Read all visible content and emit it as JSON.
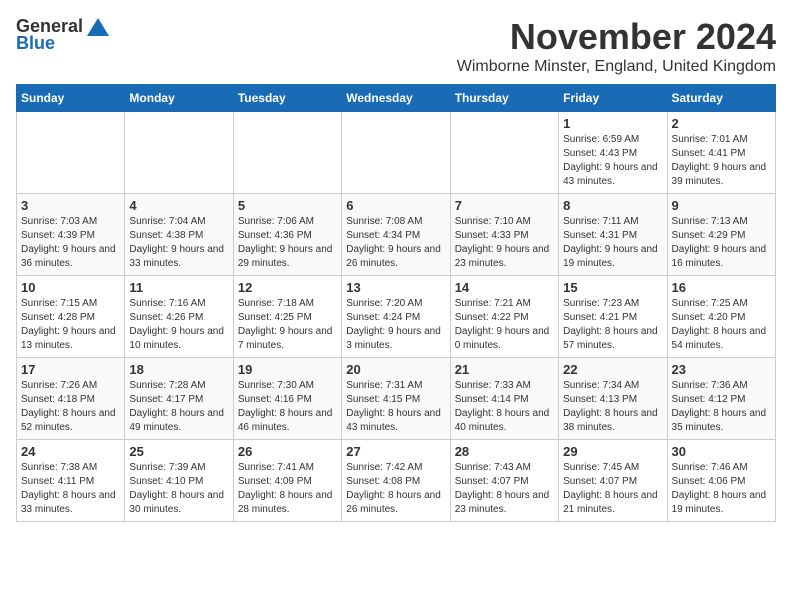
{
  "logo": {
    "general": "General",
    "blue": "Blue"
  },
  "header": {
    "month": "November 2024",
    "location": "Wimborne Minster, England, United Kingdom"
  },
  "weekdays": [
    "Sunday",
    "Monday",
    "Tuesday",
    "Wednesday",
    "Thursday",
    "Friday",
    "Saturday"
  ],
  "weeks": [
    [
      {
        "day": "",
        "info": ""
      },
      {
        "day": "",
        "info": ""
      },
      {
        "day": "",
        "info": ""
      },
      {
        "day": "",
        "info": ""
      },
      {
        "day": "",
        "info": ""
      },
      {
        "day": "1",
        "info": "Sunrise: 6:59 AM\nSunset: 4:43 PM\nDaylight: 9 hours and 43 minutes."
      },
      {
        "day": "2",
        "info": "Sunrise: 7:01 AM\nSunset: 4:41 PM\nDaylight: 9 hours and 39 minutes."
      }
    ],
    [
      {
        "day": "3",
        "info": "Sunrise: 7:03 AM\nSunset: 4:39 PM\nDaylight: 9 hours and 36 minutes."
      },
      {
        "day": "4",
        "info": "Sunrise: 7:04 AM\nSunset: 4:38 PM\nDaylight: 9 hours and 33 minutes."
      },
      {
        "day": "5",
        "info": "Sunrise: 7:06 AM\nSunset: 4:36 PM\nDaylight: 9 hours and 29 minutes."
      },
      {
        "day": "6",
        "info": "Sunrise: 7:08 AM\nSunset: 4:34 PM\nDaylight: 9 hours and 26 minutes."
      },
      {
        "day": "7",
        "info": "Sunrise: 7:10 AM\nSunset: 4:33 PM\nDaylight: 9 hours and 23 minutes."
      },
      {
        "day": "8",
        "info": "Sunrise: 7:11 AM\nSunset: 4:31 PM\nDaylight: 9 hours and 19 minutes."
      },
      {
        "day": "9",
        "info": "Sunrise: 7:13 AM\nSunset: 4:29 PM\nDaylight: 9 hours and 16 minutes."
      }
    ],
    [
      {
        "day": "10",
        "info": "Sunrise: 7:15 AM\nSunset: 4:28 PM\nDaylight: 9 hours and 13 minutes."
      },
      {
        "day": "11",
        "info": "Sunrise: 7:16 AM\nSunset: 4:26 PM\nDaylight: 9 hours and 10 minutes."
      },
      {
        "day": "12",
        "info": "Sunrise: 7:18 AM\nSunset: 4:25 PM\nDaylight: 9 hours and 7 minutes."
      },
      {
        "day": "13",
        "info": "Sunrise: 7:20 AM\nSunset: 4:24 PM\nDaylight: 9 hours and 3 minutes."
      },
      {
        "day": "14",
        "info": "Sunrise: 7:21 AM\nSunset: 4:22 PM\nDaylight: 9 hours and 0 minutes."
      },
      {
        "day": "15",
        "info": "Sunrise: 7:23 AM\nSunset: 4:21 PM\nDaylight: 8 hours and 57 minutes."
      },
      {
        "day": "16",
        "info": "Sunrise: 7:25 AM\nSunset: 4:20 PM\nDaylight: 8 hours and 54 minutes."
      }
    ],
    [
      {
        "day": "17",
        "info": "Sunrise: 7:26 AM\nSunset: 4:18 PM\nDaylight: 8 hours and 52 minutes."
      },
      {
        "day": "18",
        "info": "Sunrise: 7:28 AM\nSunset: 4:17 PM\nDaylight: 8 hours and 49 minutes."
      },
      {
        "day": "19",
        "info": "Sunrise: 7:30 AM\nSunset: 4:16 PM\nDaylight: 8 hours and 46 minutes."
      },
      {
        "day": "20",
        "info": "Sunrise: 7:31 AM\nSunset: 4:15 PM\nDaylight: 8 hours and 43 minutes."
      },
      {
        "day": "21",
        "info": "Sunrise: 7:33 AM\nSunset: 4:14 PM\nDaylight: 8 hours and 40 minutes."
      },
      {
        "day": "22",
        "info": "Sunrise: 7:34 AM\nSunset: 4:13 PM\nDaylight: 8 hours and 38 minutes."
      },
      {
        "day": "23",
        "info": "Sunrise: 7:36 AM\nSunset: 4:12 PM\nDaylight: 8 hours and 35 minutes."
      }
    ],
    [
      {
        "day": "24",
        "info": "Sunrise: 7:38 AM\nSunset: 4:11 PM\nDaylight: 8 hours and 33 minutes."
      },
      {
        "day": "25",
        "info": "Sunrise: 7:39 AM\nSunset: 4:10 PM\nDaylight: 8 hours and 30 minutes."
      },
      {
        "day": "26",
        "info": "Sunrise: 7:41 AM\nSunset: 4:09 PM\nDaylight: 8 hours and 28 minutes."
      },
      {
        "day": "27",
        "info": "Sunrise: 7:42 AM\nSunset: 4:08 PM\nDaylight: 8 hours and 26 minutes."
      },
      {
        "day": "28",
        "info": "Sunrise: 7:43 AM\nSunset: 4:07 PM\nDaylight: 8 hours and 23 minutes."
      },
      {
        "day": "29",
        "info": "Sunrise: 7:45 AM\nSunset: 4:07 PM\nDaylight: 8 hours and 21 minutes."
      },
      {
        "day": "30",
        "info": "Sunrise: 7:46 AM\nSunset: 4:06 PM\nDaylight: 8 hours and 19 minutes."
      }
    ]
  ]
}
